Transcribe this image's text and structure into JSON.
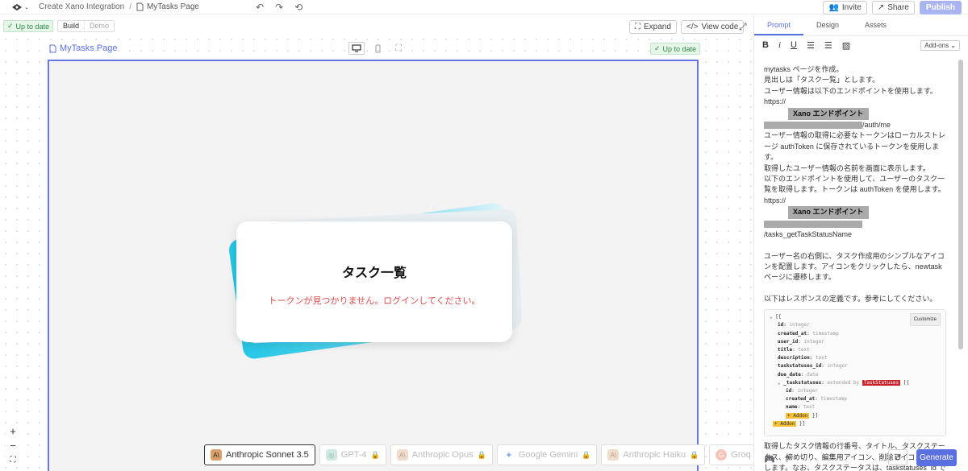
{
  "topbar": {
    "breadcrumb_project": "Create Xano Integration",
    "breadcrumb_sep": "/",
    "breadcrumb_page": "MyTasks Page",
    "invite": "Invite",
    "share": "Share",
    "publish": "Publish"
  },
  "bar2": {
    "status": "Up to date",
    "build": "Build",
    "demo": "Demo",
    "expand": "Expand",
    "view_code": "View code"
  },
  "canvas": {
    "page_label": "MyTasks Page",
    "status": "Up to date",
    "card_title": "タスク一覧",
    "card_error": "トークンが見つかりません。ログインしてください。"
  },
  "models": [
    {
      "label": "Anthropic Sonnet 3.5",
      "selected": true
    },
    {
      "label": "GPT-4"
    },
    {
      "label": "Anthropic Opus"
    },
    {
      "label": "Google Gemini"
    },
    {
      "label": "Anthropic Haiku"
    },
    {
      "label": "Groq"
    }
  ],
  "panel": {
    "tabs": [
      "Prompt",
      "Design",
      "Assets"
    ],
    "addons": "Add-ons",
    "prompt": {
      "l1": "mytasks ページを作成。",
      "l2": "見出しは「タスク一覧」とします。",
      "l3": "ユーザー情報は以下のエンドポイントを使用します。",
      "l4": "https://",
      "redact1": "Xano エンドポイント",
      "l5": "/auth/me",
      "l6": "ユーザー情報の取得に必要なトークンはローカルストレージ authToken に保存されているトークンを使用します。",
      "l7": "取得したユーザー情報の名前を画面に表示します。",
      "l8": "以下のエンドポイントを使用して、ユーザーのタスク一覧を取得します。トークンは authToken を使用します。",
      "l9": "https://",
      "redact2": "Xano エンドポイント",
      "l10": "/tasks_getTaskStatusName",
      "l11": "ユーザー名の右側に、タスク作成用のシンプルなアイコンを配置します。アイコンをクリックしたら、newtask ページに遷移します。",
      "l12": "以下はレスポンスの定義です。参考にしてください。",
      "l13": "取得したタスク情報の行番号、タイトル、タスクステータス、締め切り、編集用アイコン、削除アイコンを表示します。なお、タスクステータスは、taskstatuses_id で"
    },
    "code": {
      "customize": "Customize",
      "open": "[{",
      "fields": [
        {
          "k": "id",
          "t": "integer"
        },
        {
          "k": "created_at",
          "t": "timestamp"
        },
        {
          "k": "user_id",
          "t": "integer"
        },
        {
          "k": "title",
          "t": "text"
        },
        {
          "k": "description",
          "t": "text"
        },
        {
          "k": "taskstatuses_id",
          "t": "integer"
        },
        {
          "k": "due_date",
          "t": "date"
        }
      ],
      "nested_key": "_taskstatuses",
      "nested_ext": "extended by",
      "nested_tag": "TaskStatuses",
      "nested_fields": [
        {
          "k": "id",
          "t": "integer"
        },
        {
          "k": "created_at",
          "t": "timestamp"
        },
        {
          "k": "name",
          "t": "text"
        }
      ],
      "addon": "Addon"
    },
    "generate": "Generate"
  }
}
